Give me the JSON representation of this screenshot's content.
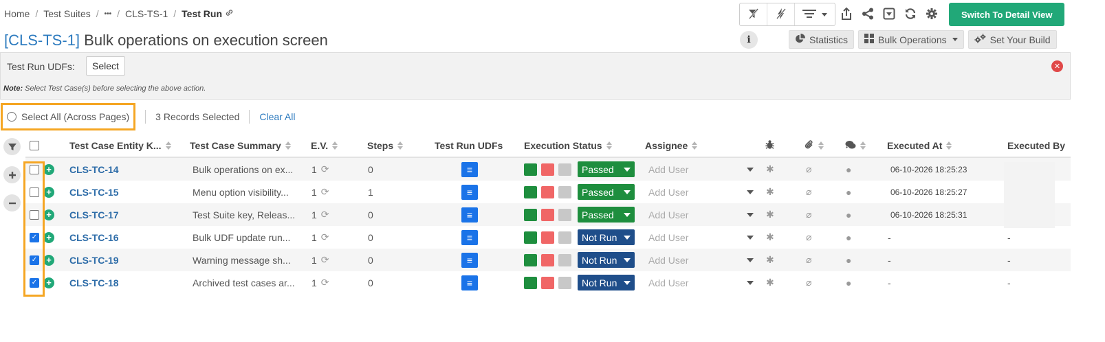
{
  "breadcrumb": {
    "items": [
      "Home",
      "Test Suites",
      "•••",
      "CLS-TS-1"
    ],
    "current": "Test Run"
  },
  "toolbar": {
    "primary_label": "Switch To Detail View"
  },
  "title": {
    "key": "[CLS-TS-1]",
    "text": "Bulk operations on execution screen"
  },
  "actions": {
    "statistics": "Statistics",
    "bulk": "Bulk Operations",
    "build": "Set Your Build"
  },
  "udf": {
    "label": "Test Run UDFs:",
    "select": "Select",
    "note_prefix": "Note:",
    "note": "Select Test Case(s) before selecting the above action."
  },
  "selection": {
    "select_all": "Select All (Across Pages)",
    "records": "3 Records Selected",
    "clear": "Clear All"
  },
  "columns": {
    "key": "Test Case Entity K...",
    "summary": "Test Case Summary",
    "ev": "E.V.",
    "steps": "Steps",
    "udfs": "Test Run UDFs",
    "status": "Execution Status",
    "assignee": "Assignee",
    "executed_at": "Executed At",
    "executed_by": "Executed By"
  },
  "rows": [
    {
      "key": "CLS-TC-14",
      "summary": "Bulk operations on ex...",
      "ev": "1",
      "steps": "0",
      "status": "Passed",
      "assignee": "Add User",
      "executed_at": "06-10-2026 18:25:23",
      "executed_by": "",
      "checked": false
    },
    {
      "key": "CLS-TC-15",
      "summary": "Menu option visibility...",
      "ev": "1",
      "steps": "1",
      "status": "Passed",
      "assignee": "Add User",
      "executed_at": "06-10-2026 18:25:27",
      "executed_by": "",
      "checked": false
    },
    {
      "key": "CLS-TC-17",
      "summary": "Test Suite key, Releas...",
      "ev": "1",
      "steps": "0",
      "status": "Passed",
      "assignee": "Add User",
      "executed_at": "06-10-2026 18:25:31",
      "executed_by": "",
      "checked": false
    },
    {
      "key": "CLS-TC-16",
      "summary": "Bulk UDF update run...",
      "ev": "1",
      "steps": "0",
      "status": "Not Run",
      "assignee": "Add User",
      "executed_at": "-",
      "executed_by": "-",
      "checked": true
    },
    {
      "key": "CLS-TC-19",
      "summary": "Warning message sh...",
      "ev": "1",
      "steps": "0",
      "status": "Not Run",
      "assignee": "Add User",
      "executed_at": "-",
      "executed_by": "-",
      "checked": true
    },
    {
      "key": "CLS-TC-18",
      "summary": "Archived test cases ar...",
      "ev": "1",
      "steps": "0",
      "status": "Not Run",
      "assignee": "Add User",
      "executed_at": "-",
      "executed_by": "-",
      "checked": true
    }
  ],
  "colors": {
    "primary": "#21a878",
    "link": "#2d7bbf",
    "passed": "#1e8e3e",
    "not_run": "#1f4e8a",
    "highlight": "#f5a623"
  }
}
